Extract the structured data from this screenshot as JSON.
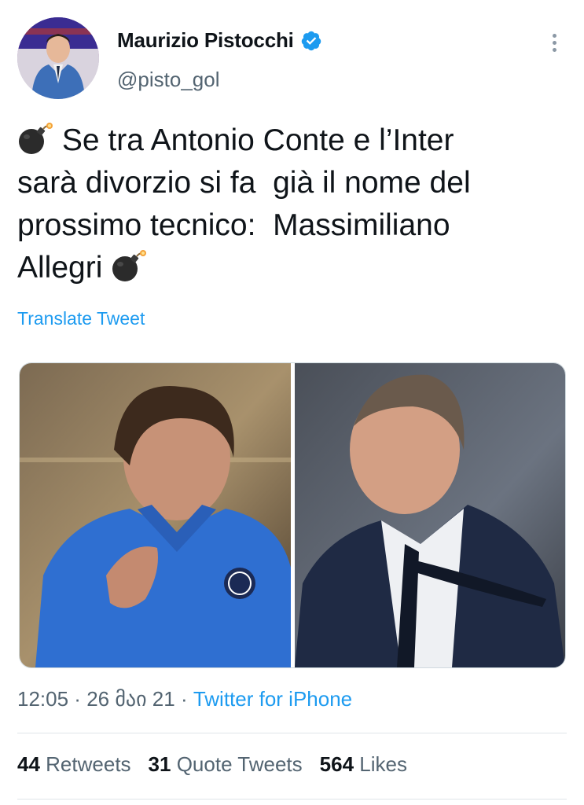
{
  "user": {
    "display_name": "Maurizio Pistocchi",
    "handle": "@pisto_gol",
    "verified": true
  },
  "tweet": {
    "line1": "Se tra Antonio Conte e l’Inter",
    "line2": "sarà divorzio si fa  già il nome del",
    "line3": "prossimo tecnico:  Massimiliano",
    "line4": "Allegri",
    "emoji": "bomb-emoji"
  },
  "translate_label": "Translate Tweet",
  "meta": {
    "time": "12:05",
    "sep1": " · ",
    "date": "26 მაი 21",
    "sep2": " · ",
    "source": "Twitter for iPhone"
  },
  "stats": {
    "retweets_count": "44",
    "retweets_label": "Retweets",
    "quotes_count": "31",
    "quotes_label": "Quote Tweets",
    "likes_count": "564",
    "likes_label": "Likes"
  },
  "colors": {
    "accent": "#1d9bf0",
    "text": "#0f1419",
    "secondary": "#536471"
  }
}
